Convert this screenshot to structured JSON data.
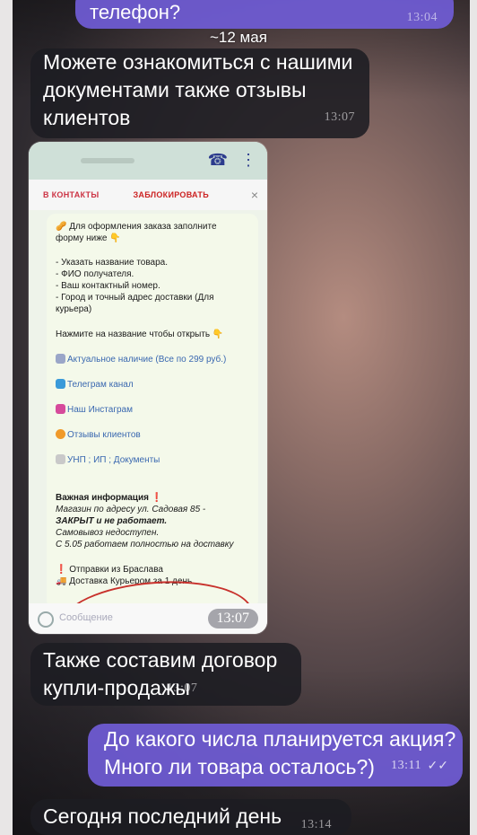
{
  "chat": {
    "top_partial": {
      "text": "телефон?",
      "time": "13:04"
    },
    "date_divider": "~12 мая",
    "messages": [
      {
        "text": "Можете ознакомиться с нашими документами также отзывы клиентов",
        "time": "13:07",
        "direction": "incoming"
      },
      {
        "text": "Также составим договор купли-продажы",
        "time": "13:07",
        "direction": "incoming"
      },
      {
        "text": "До какого числа планируется акция? Много ли товара осталось?)",
        "time": "13:11",
        "direction": "outgoing",
        "status": "read"
      },
      {
        "text": "Сегодня последний день",
        "time": "13:14",
        "direction": "incoming"
      }
    ]
  },
  "screenshot": {
    "top_bar": {
      "add_contact": "В КОНТАКТЫ",
      "block": "ЗАБЛОКИРОВАТЬ"
    },
    "lines": [
      "Для оформления заказа заполните",
      "форму ниже",
      "- Указать название товара.",
      "- ФИО получателя.",
      "- Ваш контактный номер.",
      "- Город и точный адрес доставки (Для",
      "курьера)",
      "Нажмите на название чтобы открыть",
      "Актуальное наличие (Все по 299 руб.)",
      "Телеграм канал",
      "Наш Инстаграм",
      "Отзывы клиентов",
      "УНП ; ИП ; Документы",
      "Важная информация",
      "Магазин по адресу ул. Садовая 85 -",
      "ЗАКРЫТ и не работает.",
      "Самовывоз недоступен.",
      "С 5.05 работаем полностью на доставку",
      "Отправки из Браслава",
      "Доставка Курьером за 1 день"
    ],
    "input_placeholder": "Сообщение",
    "time_badge": "13:07"
  },
  "colors": {
    "incoming": "#1c1c22",
    "outgoing": "#705cd6",
    "annotation_circle": "#c8312c"
  }
}
